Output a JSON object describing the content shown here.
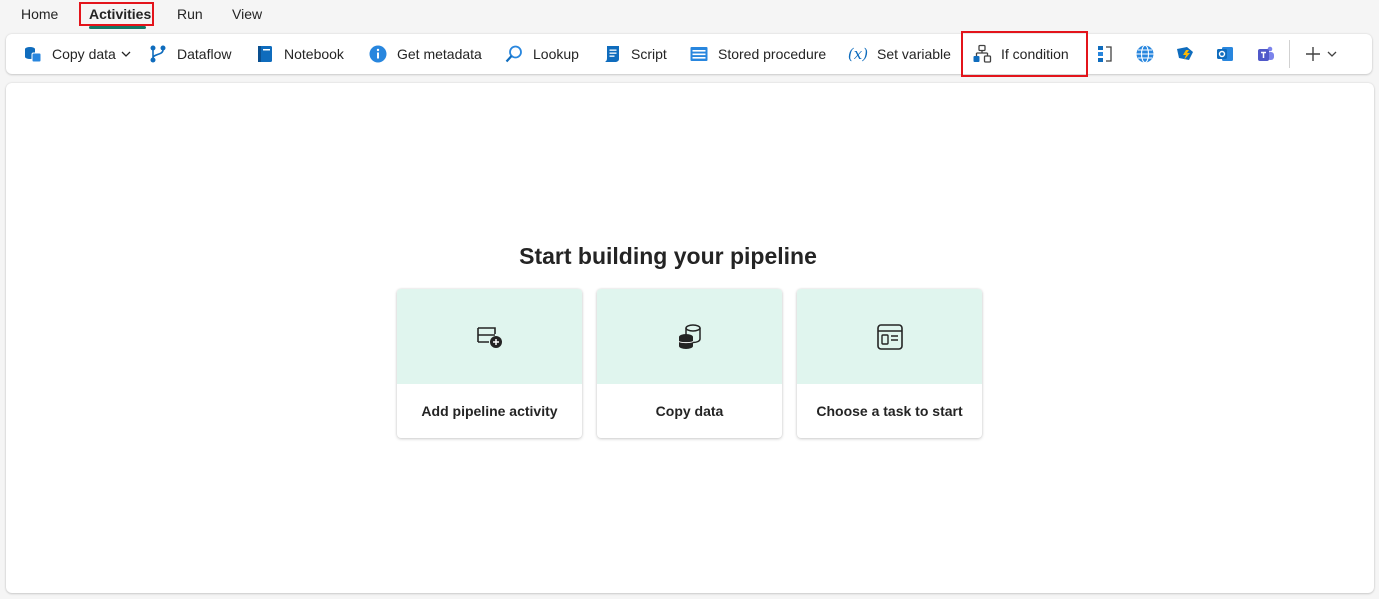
{
  "tabs": [
    {
      "label": "Home",
      "active": false
    },
    {
      "label": "Activities",
      "active": true
    },
    {
      "label": "Run",
      "active": false
    },
    {
      "label": "View",
      "active": false
    }
  ],
  "toolbar": {
    "items": [
      {
        "label": "Copy data",
        "icon": "copy-data-icon",
        "has_dropdown": true
      },
      {
        "label": "Dataflow",
        "icon": "dataflow-icon"
      },
      {
        "label": "Notebook",
        "icon": "notebook-icon"
      },
      {
        "label": "Get metadata",
        "icon": "info-icon"
      },
      {
        "label": "Lookup",
        "icon": "lookup-icon"
      },
      {
        "label": "Script",
        "icon": "script-icon"
      },
      {
        "label": "Stored procedure",
        "icon": "stored-procedure-icon"
      },
      {
        "label": "Set variable",
        "icon": "variable-icon"
      },
      {
        "label": "If condition",
        "icon": "if-condition-icon"
      }
    ],
    "icon_only": [
      "switch-icon",
      "web-icon",
      "azure-function-icon",
      "outlook-icon",
      "teams-icon"
    ],
    "more": "plus-icon"
  },
  "canvas": {
    "heading": "Start building your pipeline",
    "cards": [
      {
        "label": "Add pipeline activity",
        "icon": "add-activity-icon"
      },
      {
        "label": "Copy data",
        "icon": "database-copy-icon"
      },
      {
        "label": "Choose a task to start",
        "icon": "task-template-icon"
      }
    ]
  },
  "colors": {
    "accent": "#117865",
    "highlight": "#e3141b",
    "card_top": "#e0f5ee",
    "icon_blue": "#0f6cbd"
  }
}
